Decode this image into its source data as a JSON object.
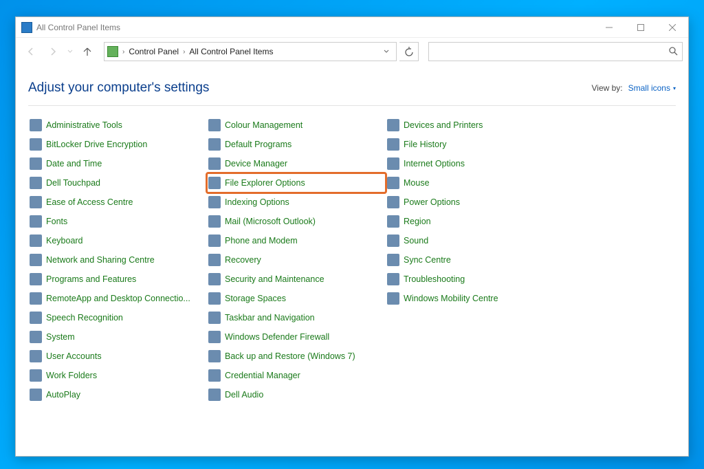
{
  "window": {
    "title": "All Control Panel Items"
  },
  "breadcrumb": {
    "root": "Control Panel",
    "leaf": "All Control Panel Items"
  },
  "search": {
    "placeholder": ""
  },
  "page": {
    "title": "Adjust your computer's settings",
    "viewby_label": "View by:",
    "viewby_value": "Small icons"
  },
  "items": [
    {
      "label": "Administrative Tools",
      "icon": "ic-folder"
    },
    {
      "label": "BitLocker Drive Encryption",
      "icon": "ic-dark"
    },
    {
      "label": "Date and Time",
      "icon": "ic-blue"
    },
    {
      "label": "Dell Touchpad",
      "icon": "ic-dark"
    },
    {
      "label": "Ease of Access Centre",
      "icon": "ic-blue"
    },
    {
      "label": "Fonts",
      "icon": "ic-folder"
    },
    {
      "label": "Keyboard",
      "icon": "ic-dark"
    },
    {
      "label": "Network and Sharing Centre",
      "icon": "ic-blue"
    },
    {
      "label": "Programs and Features",
      "icon": "ic-folder"
    },
    {
      "label": "RemoteApp and Desktop Connectio...",
      "icon": "ic-blue"
    },
    {
      "label": "Speech Recognition",
      "icon": "ic-dark"
    },
    {
      "label": "System",
      "icon": "ic-blue"
    },
    {
      "label": "User Accounts",
      "icon": "ic-green"
    },
    {
      "label": "Work Folders",
      "icon": "ic-folder"
    },
    {
      "label": "AutoPlay",
      "icon": "ic-blue"
    },
    {
      "label": "Colour Management",
      "icon": "ic-cyan"
    },
    {
      "label": "Default Programs",
      "icon": "ic-green"
    },
    {
      "label": "Device Manager",
      "icon": "ic-blue"
    },
    {
      "label": "File Explorer Options",
      "icon": "ic-folder",
      "highlighted": true
    },
    {
      "label": "Indexing Options",
      "icon": "ic-dark"
    },
    {
      "label": "Mail (Microsoft Outlook)",
      "icon": "ic-blue"
    },
    {
      "label": "Phone and Modem",
      "icon": "ic-dark"
    },
    {
      "label": "Recovery",
      "icon": "ic-cyan"
    },
    {
      "label": "Security and Maintenance",
      "icon": "ic-green"
    },
    {
      "label": "Storage Spaces",
      "icon": "ic-dark"
    },
    {
      "label": "Taskbar and Navigation",
      "icon": "ic-blue"
    },
    {
      "label": "Windows Defender Firewall",
      "icon": "ic-red"
    },
    {
      "label": "Back up and Restore (Windows 7)",
      "icon": "ic-green"
    },
    {
      "label": "Credential Manager",
      "icon": "ic-folder"
    },
    {
      "label": "Dell Audio",
      "icon": "ic-blue"
    },
    {
      "label": "Devices and Printers",
      "icon": "ic-dark"
    },
    {
      "label": "File History",
      "icon": "ic-folder"
    },
    {
      "label": "Internet Options",
      "icon": "ic-cyan"
    },
    {
      "label": "Mouse",
      "icon": "ic-dark"
    },
    {
      "label": "Power Options",
      "icon": "ic-green"
    },
    {
      "label": "Region",
      "icon": "ic-blue"
    },
    {
      "label": "Sound",
      "icon": "ic-dark"
    },
    {
      "label": "Sync Centre",
      "icon": "ic-green"
    },
    {
      "label": "Troubleshooting",
      "icon": "ic-blue"
    },
    {
      "label": "Windows Mobility Centre",
      "icon": "ic-blue"
    }
  ]
}
